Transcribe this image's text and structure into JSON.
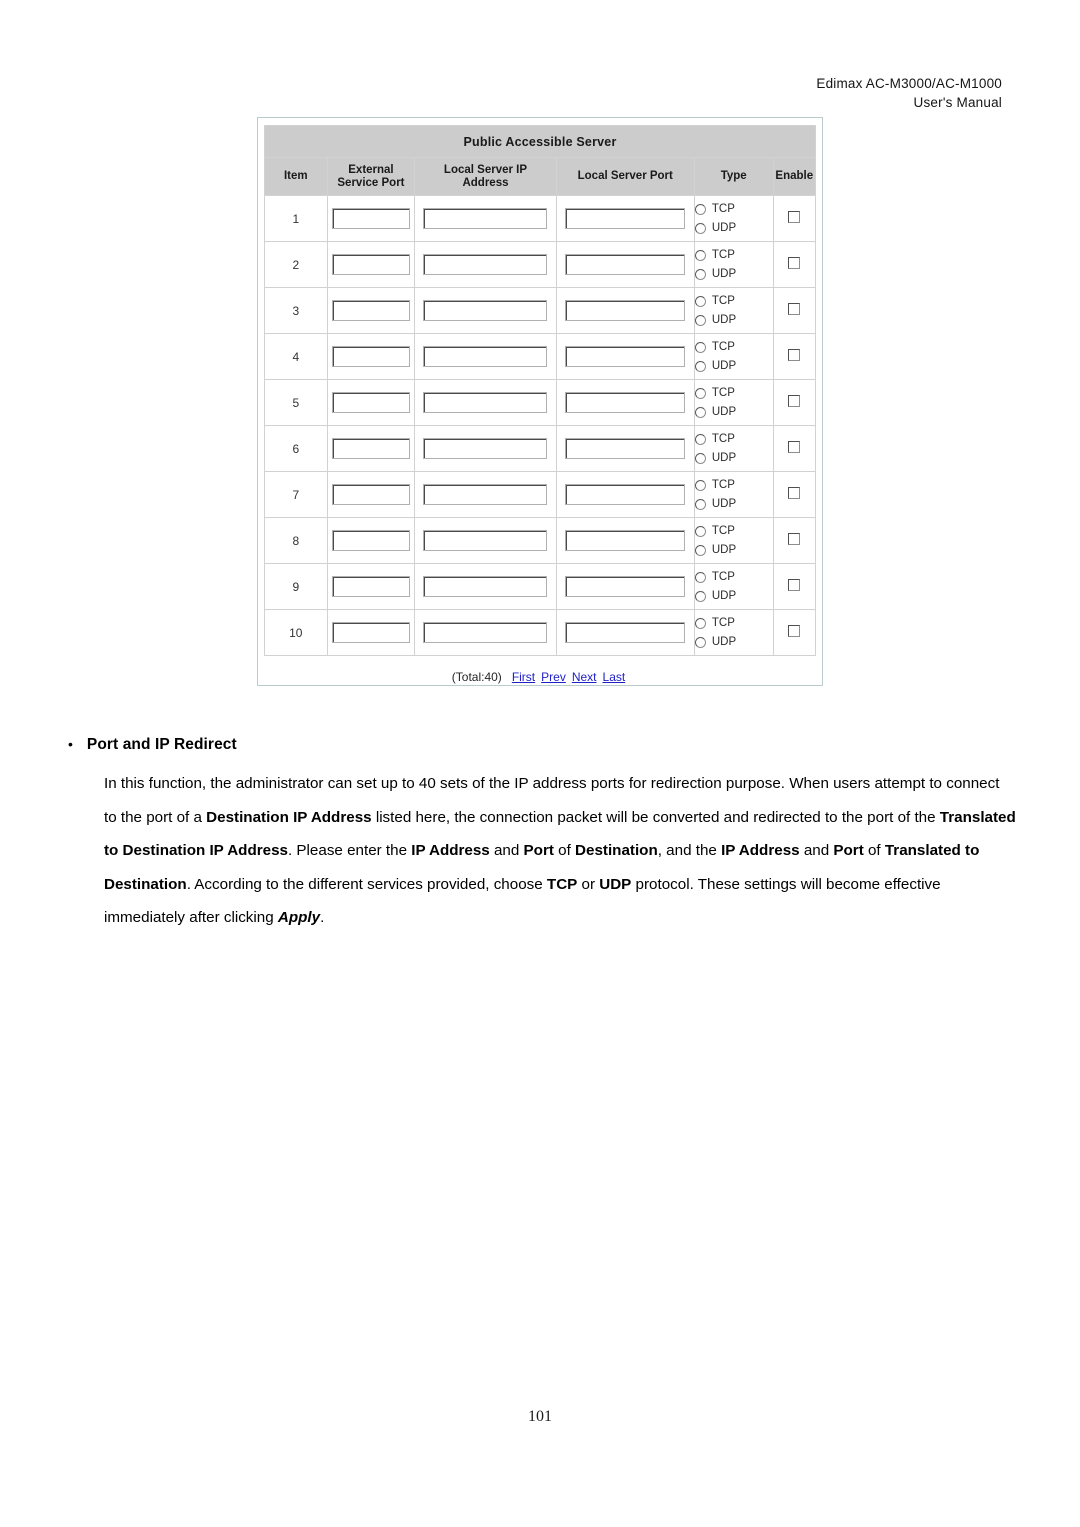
{
  "header": {
    "line1": "Edimax  AC-M3000/AC-M1000",
    "line2": "User's  Manual"
  },
  "screenshot": {
    "title": "Public Accessible Server",
    "columns": {
      "item": "Item",
      "external_service_port": "External\nService Port",
      "external_service_port_l1": "External",
      "external_service_port_l2": "Service Port",
      "local_server_ip_l1": "Local Server IP",
      "local_server_ip_l2": "Address",
      "local_server_port": "Local Server Port",
      "type": "Type",
      "enable": "Enable"
    },
    "rows": [
      {
        "item": "1",
        "external_service_port": "",
        "local_server_ip": "",
        "local_server_port": "",
        "type": "",
        "enable": false
      },
      {
        "item": "2",
        "external_service_port": "",
        "local_server_ip": "",
        "local_server_port": "",
        "type": "",
        "enable": false
      },
      {
        "item": "3",
        "external_service_port": "",
        "local_server_ip": "",
        "local_server_port": "",
        "type": "",
        "enable": false
      },
      {
        "item": "4",
        "external_service_port": "",
        "local_server_ip": "",
        "local_server_port": "",
        "type": "",
        "enable": false
      },
      {
        "item": "5",
        "external_service_port": "",
        "local_server_ip": "",
        "local_server_port": "",
        "type": "",
        "enable": false
      },
      {
        "item": "6",
        "external_service_port": "",
        "local_server_ip": "",
        "local_server_port": "",
        "type": "",
        "enable": false
      },
      {
        "item": "7",
        "external_service_port": "",
        "local_server_ip": "",
        "local_server_port": "",
        "type": "",
        "enable": false
      },
      {
        "item": "8",
        "external_service_port": "",
        "local_server_ip": "",
        "local_server_port": "",
        "type": "",
        "enable": false
      },
      {
        "item": "9",
        "external_service_port": "",
        "local_server_ip": "",
        "local_server_port": "",
        "type": "",
        "enable": false
      },
      {
        "item": "10",
        "external_service_port": "",
        "local_server_ip": "",
        "local_server_port": "",
        "type": "",
        "enable": false
      }
    ],
    "type_options": {
      "tcp": "TCP",
      "udp": "UDP"
    },
    "pager": {
      "total": "(Total:40)",
      "first": "First",
      "prev": "Prev",
      "next": "Next",
      "last": "Last"
    },
    "link_color": "#2020c8",
    "header_bg": "#cccccc"
  },
  "section": {
    "bullet": "•",
    "title": "Port and IP Redirect",
    "paragraph": {
      "t1": "In this function, the administrator can set up to 40 sets of the IP address ports for redirection purpose. When users attempt to connect to the port of a ",
      "b1": "Destination IP Address",
      "t2": " listed here, the connection packet will be converted and redirected to the port of the ",
      "b2": "Translated to Destination IP Address",
      "t3": ". Please enter the ",
      "b3": "IP Address",
      "t4": " and ",
      "b4": "Port",
      "t5": " of ",
      "b5": "Destination",
      "t6": ", and the ",
      "b6": "IP Address",
      "t7": " and ",
      "b7": "Port",
      "t8": " of ",
      "b8": "Translated to Destination",
      "t9": ". According to the different services provided, choose ",
      "b9": "TCP",
      "t10": " or ",
      "b10": "UDP",
      "t11": " protocol. These settings will become effective immediately after clicking ",
      "b11": "Apply",
      "t12": "."
    }
  },
  "footer": {
    "page_number": "101"
  }
}
